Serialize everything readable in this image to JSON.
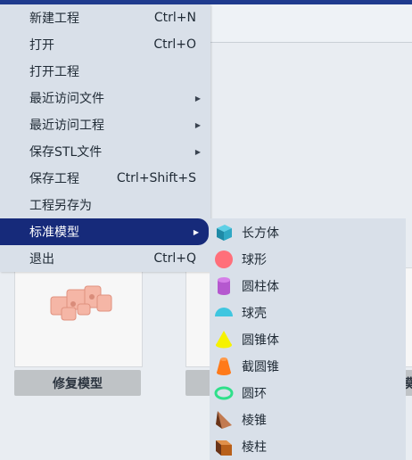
{
  "file_menu": {
    "items": [
      {
        "label": "新建工程",
        "shortcut": "Ctrl+N"
      },
      {
        "label": "打开",
        "shortcut": "Ctrl+O"
      },
      {
        "label": "打开工程",
        "shortcut": ""
      },
      {
        "label": "最近访问文件",
        "shortcut": ""
      },
      {
        "label": "最近访问工程",
        "shortcut": ""
      },
      {
        "label": "保存STL文件",
        "shortcut": ""
      },
      {
        "label": "保存工程",
        "shortcut": "Ctrl+Shift+S"
      },
      {
        "label": "工程另存为",
        "shortcut": ""
      },
      {
        "label": "标准模型",
        "shortcut": ""
      },
      {
        "label": "退出",
        "shortcut": "Ctrl+Q"
      }
    ]
  },
  "standard_models": {
    "items": [
      {
        "label": "长方体",
        "icon": "cube-icon",
        "color": "#2c9fb8"
      },
      {
        "label": "球形",
        "icon": "sphere-icon",
        "color": "#ff6f7a"
      },
      {
        "label": "圆柱体",
        "icon": "cylinder-icon",
        "color": "#b558cf"
      },
      {
        "label": "球壳",
        "icon": "sphere-shell-icon",
        "color": "#3fc6e0"
      },
      {
        "label": "圆锥体",
        "icon": "cone-icon",
        "color": "#f6f200"
      },
      {
        "label": "截圆锥",
        "icon": "truncated-cone-icon",
        "color": "#ff7a1a"
      },
      {
        "label": "圆环",
        "icon": "torus-icon",
        "color": "#2fe08a"
      },
      {
        "label": "棱锥",
        "icon": "pyramid-icon",
        "color": "#8a4a2a"
      },
      {
        "label": "棱柱",
        "icon": "prism-icon",
        "color": "#b8601a"
      }
    ]
  },
  "model_cards": [
    {
      "label": "修复模型"
    },
    {
      "label": ""
    },
    {
      "label": "模"
    }
  ]
}
